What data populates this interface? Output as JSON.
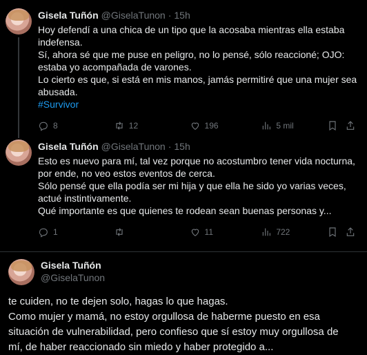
{
  "tweets": [
    {
      "name": "Gisela Tuñón",
      "handle": "@GiselaTunon",
      "dot": "·",
      "time": "15h",
      "text": "Hoy defendí a una chica de un tipo que la acosaba mientras ella estaba\nindefensa.\nSí, ahora sé que me puse en peligro, no lo pensé, sólo reaccioné; OJO:\nestaba yo acompañada de varones.\nLo cierto es que, si está en mis manos, jamás permitiré que una mujer sea\nabusada.",
      "hashtag": "#Survivor",
      "replies": "8",
      "retweets": "12",
      "likes": "196",
      "views": "5 mil"
    },
    {
      "name": "Gisela Tuñón",
      "handle": "@GiselaTunon",
      "dot": "·",
      "time": "15h",
      "text": "Esto es nuevo para mí, tal vez porque no acostumbro tener vida nocturna,\npor ende, no veo estos eventos de cerca.\nSólo pensé que ella podía ser mi hija y que ella he sido yo varias veces,\nactué instintivamente.\nQué importante es que quienes te rodean sean buenas personas y...",
      "replies": "1",
      "retweets": "",
      "likes": "11",
      "views": "722"
    }
  ],
  "main": {
    "name": "Gisela Tuñón",
    "handle": "@GiselaTunon",
    "text": "te cuiden, no te dejen solo, hagas lo que hagas.\nComo mujer y mamá, no estoy orgullosa de haberme puesto en esa\nsituación de vulnerabilidad, pero confieso que sí estoy muy orgullosa de\nmí, de haber reaccionado sin miedo y haber protegido a..."
  },
  "icons": [
    "reply-icon",
    "retweet-icon",
    "like-icon",
    "views-icon",
    "bookmark-icon",
    "share-icon"
  ]
}
